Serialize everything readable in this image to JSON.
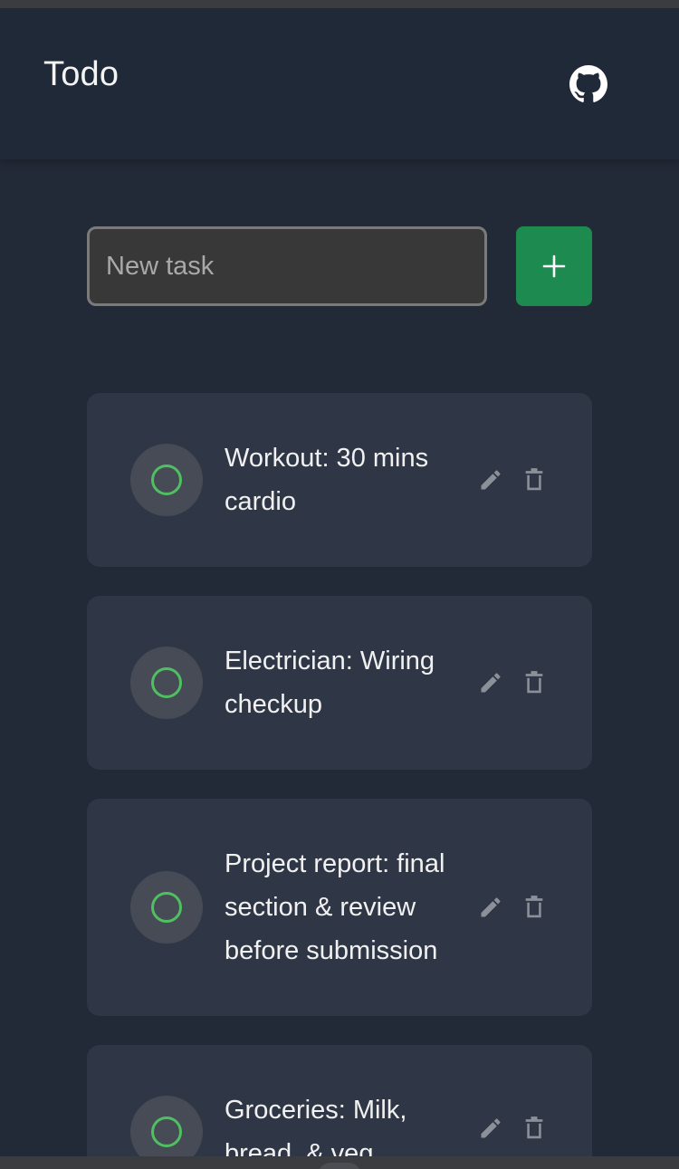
{
  "app": {
    "title": "Todo",
    "github_icon": "github-icon"
  },
  "new_task": {
    "placeholder": "New task",
    "value": "",
    "add_icon": "plus-icon"
  },
  "colors": {
    "background": "#222a38",
    "app_bar": "#202937",
    "card": "#2f3747",
    "accent_green": "#1d8a50",
    "check_ring": "#4fbf62"
  },
  "tasks": [
    {
      "text": "Workout: 30 mins cardio",
      "completed": false,
      "edit_icon": "pencil-icon",
      "delete_icon": "trash-icon"
    },
    {
      "text": "Electrician: Wiring checkup",
      "completed": false,
      "edit_icon": "pencil-icon",
      "delete_icon": "trash-icon"
    },
    {
      "text": "Project report: final section & review before submission",
      "completed": false,
      "edit_icon": "pencil-icon",
      "delete_icon": "trash-icon"
    },
    {
      "text": "Groceries: Milk, bread, & veg",
      "completed": false,
      "edit_icon": "pencil-icon",
      "delete_icon": "trash-icon"
    }
  ]
}
